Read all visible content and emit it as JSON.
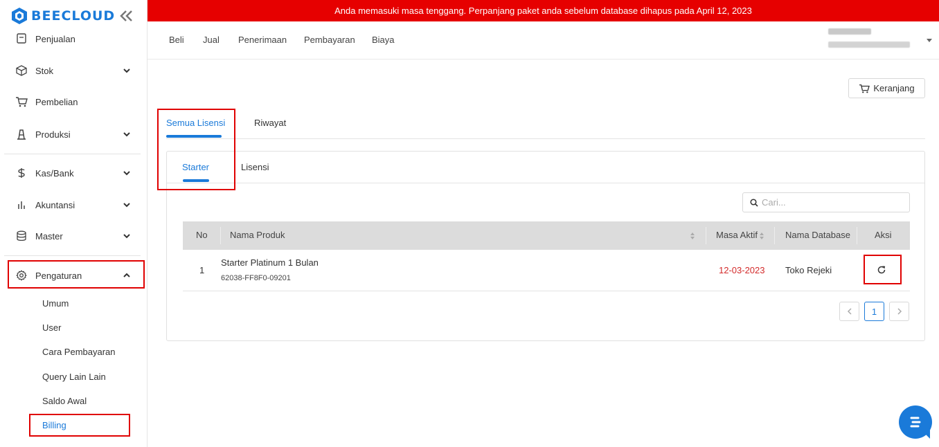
{
  "app": {
    "logo_text": "BEECLOUD",
    "brand_color": "#1a7ad9",
    "alert_color": "#e60000",
    "highlight_color": "#e00000"
  },
  "banner": {
    "text": "Anda memasuki masa tenggang. Perpanjang paket anda sebelum database dihapus pada April 12, 2023"
  },
  "sidebar": {
    "items": [
      {
        "label": "Penjualan",
        "icon": "receipt-icon",
        "has_chevron": false
      },
      {
        "label": "Stok",
        "icon": "box-icon",
        "has_chevron": true
      },
      {
        "label": "Pembelian",
        "icon": "cart-icon",
        "has_chevron": false
      },
      {
        "label": "Produksi",
        "icon": "factory-icon",
        "has_chevron": true
      },
      {
        "label": "Kas/Bank",
        "icon": "dollar-icon",
        "has_chevron": true
      },
      {
        "label": "Akuntansi",
        "icon": "bar-chart-icon",
        "has_chevron": true
      },
      {
        "label": "Master",
        "icon": "database-icon",
        "has_chevron": true
      },
      {
        "label": "Pengaturan",
        "icon": "gear-icon",
        "has_chevron": true,
        "expanded": true
      }
    ],
    "sub_items": [
      {
        "label": "Umum"
      },
      {
        "label": "User"
      },
      {
        "label": "Cara Pembayaran"
      },
      {
        "label": "Query Lain Lain"
      },
      {
        "label": "Saldo Awal"
      },
      {
        "label": "Billing",
        "active": true
      }
    ]
  },
  "topnav": {
    "links": [
      "Beli",
      "Jual",
      "Penerimaan",
      "Pembayaran",
      "Biaya"
    ]
  },
  "cart_button": {
    "label": "Keranjang",
    "icon": "cart-icon"
  },
  "main_tabs": [
    {
      "label": "Semua Lisensi",
      "active": true
    },
    {
      "label": "Riwayat",
      "active": false
    }
  ],
  "sub_tabs": [
    {
      "label": "Starter",
      "active": true
    },
    {
      "label": "Lisensi",
      "active": false
    }
  ],
  "search": {
    "placeholder": "Cari...",
    "icon": "search-icon"
  },
  "table": {
    "headers": {
      "no": "No",
      "product": "Nama Produk",
      "active_until": "Masa Aktif",
      "database": "Nama Database",
      "action": "Aksi"
    },
    "rows": [
      {
        "no": "1",
        "product_name": "Starter Platinum 1 Bulan",
        "product_code": "62038-FF8F0-09201",
        "active_until": "12-03-2023",
        "database": "Toko Rejeki",
        "action_icon": "refresh-icon"
      }
    ]
  },
  "pagination": {
    "current": "1",
    "prev_icon": "chevron-left-icon",
    "next_icon": "chevron-right-icon"
  }
}
